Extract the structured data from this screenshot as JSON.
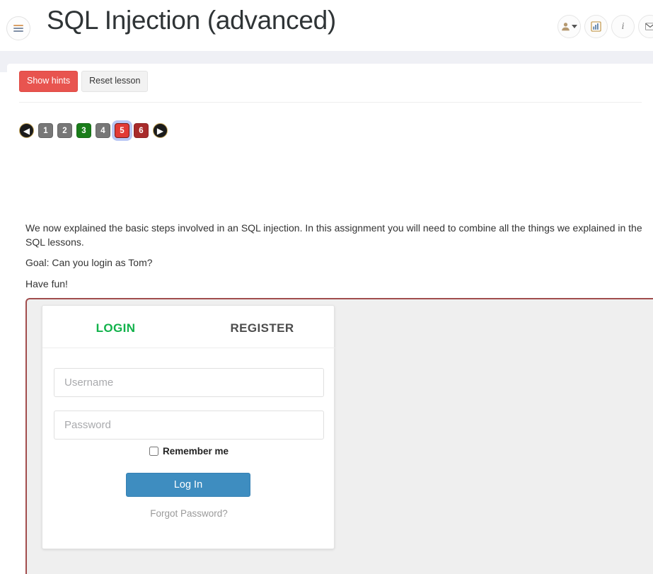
{
  "header": {
    "title": "SQL Injection (advanced)",
    "menu_icon": "hamburger-icon",
    "icons": [
      {
        "name": "user-icon",
        "label": "User menu",
        "has_caret": true
      },
      {
        "name": "chart-icon",
        "label": "Scoreboard"
      },
      {
        "name": "info-icon",
        "label": "About",
        "glyph": "i"
      },
      {
        "name": "envelope-icon",
        "label": "Messages"
      }
    ]
  },
  "toolbar": {
    "show_hints_label": "Show hints",
    "reset_lesson_label": "Reset lesson"
  },
  "pagination": {
    "prev_label": "◀",
    "next_label": "▶",
    "pages": [
      {
        "label": "1",
        "state": "visited"
      },
      {
        "label": "2",
        "state": "visited"
      },
      {
        "label": "3",
        "state": "solved"
      },
      {
        "label": "4",
        "state": "visited"
      },
      {
        "label": "5",
        "state": "current"
      },
      {
        "label": "6",
        "state": "unsolved"
      }
    ]
  },
  "lesson": {
    "paragraph1": "We now explained the basic steps involved in an SQL injection. In this assignment you will need to combine all the things we explained in the SQL lessons.",
    "paragraph2": "Goal: Can you login as Tom?",
    "paragraph3": "Have fun!"
  },
  "login_form": {
    "tab_login": "LOGIN",
    "tab_register": "REGISTER",
    "username_value": "",
    "username_placeholder": "Username",
    "password_value": "",
    "password_placeholder": "Password",
    "remember_label": "Remember me",
    "remember_checked": false,
    "submit_label": "Log In",
    "forgot_label": "Forgot Password?"
  },
  "colors": {
    "danger": "#e8544f",
    "accent_green": "#12b24b",
    "primary_blue": "#3e8dc0",
    "container_border": "#a14d4d",
    "band": "#eff0f5"
  }
}
